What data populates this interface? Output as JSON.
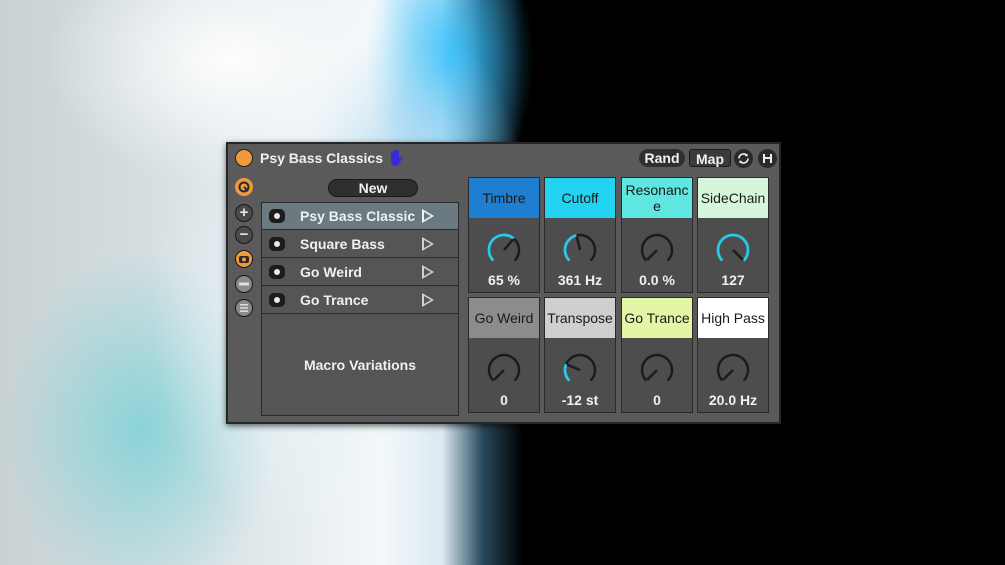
{
  "device": {
    "title": "Psy Bass Classics",
    "rand_label": "Rand",
    "map_label": "Map",
    "new_label": "New",
    "section_label": "Macro Variations",
    "accent_color": "#f19a3b",
    "hand_icon_color": "#3b2bd6"
  },
  "presets": [
    {
      "name": "Psy Bass Classic",
      "selected": true
    },
    {
      "name": "Square Bass",
      "selected": false
    },
    {
      "name": "Go Weird",
      "selected": false
    },
    {
      "name": "Go Trance",
      "selected": false
    }
  ],
  "macros": [
    {
      "label": "Timbre",
      "value": "65 %",
      "color": "#1e7fd0",
      "level": 0.65,
      "arc_color": "#2bc8e8"
    },
    {
      "label": "Cutoff",
      "value": "361 Hz",
      "color": "#21d3f0",
      "level": 0.45,
      "arc_color": "#2bc8e8"
    },
    {
      "label": "Resonance",
      "value": "0.0 %",
      "color": "#5ee6e0",
      "level": 0.0,
      "arc_color": "#2bc8e8"
    },
    {
      "label": "SideChain",
      "value": "127",
      "color": "#d6f6dc",
      "level": 1.0,
      "arc_color": "#2bc8e8"
    },
    {
      "label": "Go Weird",
      "value": "0",
      "color": "#8c8c8c",
      "level": 0.0,
      "arc_color": "#2bc8e8"
    },
    {
      "label": "Transpose",
      "value": "-12 st",
      "color": "#cfcfcf",
      "level": 0.25,
      "arc_color": "#2bc8e8"
    },
    {
      "label": "Go Trance",
      "value": "0",
      "color": "#e2f6a6",
      "level": 0.0,
      "arc_color": "#2bc8e8"
    },
    {
      "label": "High Pass",
      "value": "20.0 Hz",
      "color": "#ffffff",
      "level": 0.0,
      "arc_color": "#2bc8e8"
    }
  ]
}
